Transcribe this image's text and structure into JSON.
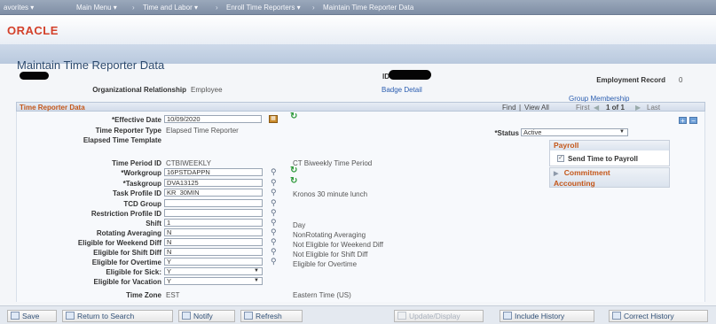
{
  "nav": {
    "favorites": "avorites ▾",
    "main_menu": "Main Menu ▾",
    "sep": "›",
    "time_labor": "Time and Labor ▾",
    "enroll": "Enroll Time Reporters ▾",
    "maintain": "Maintain Time Reporter Data"
  },
  "brand": {
    "logo": "ORACLE"
  },
  "page": {
    "title": "Maintain Time Reporter Data",
    "id_label": "ID",
    "employment_record_label": "Employment Record",
    "employment_record_value": "0",
    "org_rel_label": "Organizational Relationship",
    "org_rel_value": "Employee",
    "badge_detail": "Badge Detail",
    "group_membership": "Group Membership"
  },
  "section": {
    "title": "Time Reporter Data",
    "find": "Find",
    "divider": "|",
    "view_all": "View All",
    "first": "First",
    "prev_icon": "◀",
    "range": "1 of 1",
    "next_icon": "▶",
    "last": "Last",
    "plus": "+",
    "minus": "−"
  },
  "fields": {
    "effective_date_label": "*Effective Date",
    "effective_date": "10/09/2020",
    "reporter_type_label": "Time Reporter Type",
    "reporter_type": "Elapsed Time Reporter",
    "elapsed_template_label": "Elapsed Time Template",
    "status_label": "*Status",
    "status_value": "Active",
    "time_period_label": "Time Period ID",
    "time_period": "CTBIWEEKLY",
    "time_period_desc": "CT Biweekly Time Period",
    "workgroup_label": "*Workgroup",
    "workgroup": "16PSTDAPPN",
    "taskgroup_label": "*Taskgroup",
    "taskgroup": "DVA13125",
    "task_profile_label": "Task Profile ID",
    "task_profile": "KR_30MIN",
    "task_profile_desc": "Kronos 30 minute lunch",
    "tcd_group_label": "TCD Group",
    "restriction_label": "Restriction Profile ID",
    "shift_label": "Shift",
    "shift": "1",
    "shift_desc": "Day",
    "rotating_label": "Rotating Averaging",
    "rotating": "N",
    "rotating_desc": "NonRotating Averaging",
    "weekend_label": "Eligible for Weekend Diff",
    "weekend": "N",
    "weekend_desc": "Not Eligible for Weekend Diff",
    "shiftdiff_label": "Eligible for Shift Diff",
    "shiftdiff": "N",
    "shiftdiff_desc": "Not Eligible for Shift Diff",
    "overtime_label": "Eligible for Overtime",
    "overtime": "Y",
    "overtime_desc": "Eligible for Overtime",
    "sick_label": "Eligible for Sick:",
    "sick": "Y",
    "vacation_label": "Eligible for Vacation",
    "vacation": "Y",
    "timezone_label": "Time Zone",
    "timezone": "EST",
    "timezone_desc": "Eastern Time (US)"
  },
  "payroll": {
    "title": "Payroll",
    "send_label": "Send Time to Payroll",
    "send_checked": true,
    "commitment_line1": "Commitment",
    "commitment_line2": "Accounting",
    "expand_icon": "▶"
  },
  "toolbar": {
    "save": "Save",
    "return": "Return to Search",
    "notify": "Notify",
    "refresh": "Refresh",
    "update": "Update/Display",
    "include_history": "Include History",
    "correct_history": "Correct History"
  }
}
